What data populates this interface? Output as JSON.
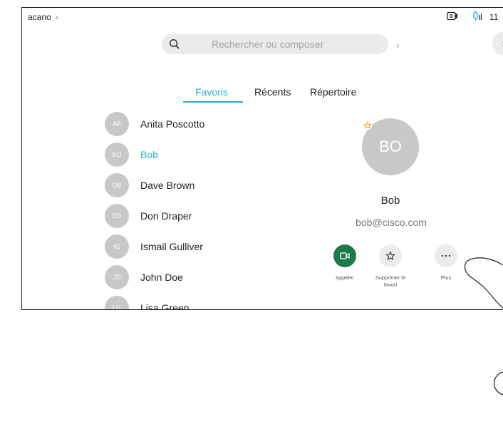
{
  "header": {
    "breadcrumb": "acano",
    "breadcrumb_chevron": "›",
    "time": "11",
    "icons": [
      "share-screen-icon",
      "mic-icon"
    ]
  },
  "search": {
    "placeholder": "Rechercher ou composer",
    "arrow": "›",
    "close": "×"
  },
  "tabs": [
    {
      "label": "Favoris",
      "active": true
    },
    {
      "label": "Récents",
      "active": false
    },
    {
      "label": "Répertoire",
      "active": false
    }
  ],
  "contacts": [
    {
      "initials": "AP",
      "name": "Anita Poscotto"
    },
    {
      "initials": "BO",
      "name": "Bob",
      "selected": true
    },
    {
      "initials": "DB",
      "name": "Dave Brown"
    },
    {
      "initials": "DD",
      "name": "Don Draper"
    },
    {
      "initials": "IG",
      "name": "Ismail Gulliver"
    },
    {
      "initials": "JD",
      "name": "John Doe"
    },
    {
      "initials": "LG",
      "name": "Lisa Green"
    }
  ],
  "detail": {
    "initials": "BO",
    "name": "Bob",
    "email": "bob@cisco.com",
    "actions": [
      {
        "label": "Appeler",
        "icon": "video-camera-icon",
        "color": "#1f7a4a"
      },
      {
        "label": "Supprimer le favori",
        "icon": "star-icon",
        "color": "#ececec"
      },
      {
        "label": "Plus",
        "icon": "more-dots-icon",
        "color": "#ececec"
      }
    ]
  },
  "colors": {
    "accent": "#2baed6",
    "call_green": "#1f7a4a",
    "favorite_star": "#f5a623"
  }
}
